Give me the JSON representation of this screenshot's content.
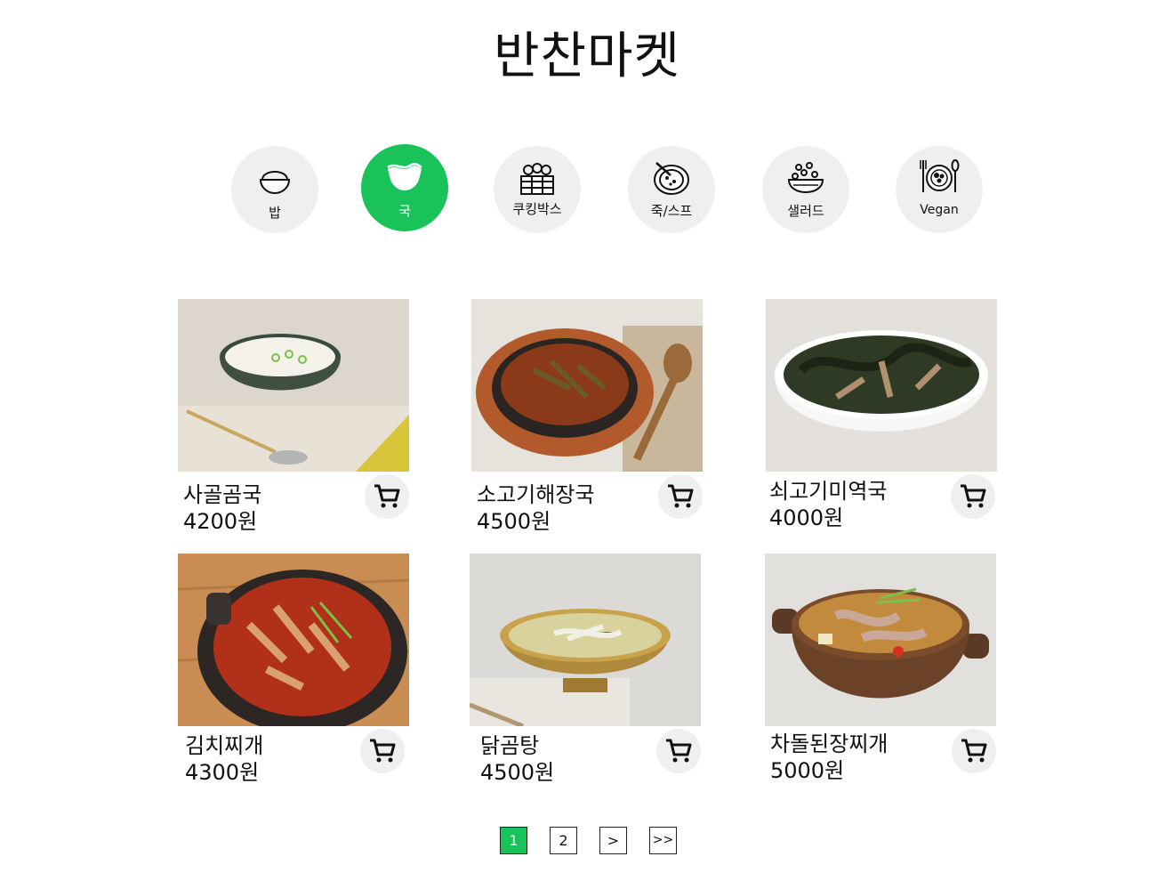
{
  "header": {
    "title": "반찬마켓"
  },
  "categories": [
    {
      "label": "밥",
      "icon": "rice-bowl-icon",
      "active": false
    },
    {
      "label": "국",
      "icon": "soup-bowl-icon",
      "active": true
    },
    {
      "label": "쿠킹박스",
      "icon": "cooking-box-icon",
      "active": false
    },
    {
      "label": "죽/스프",
      "icon": "porridge-icon",
      "active": false
    },
    {
      "label": "샐러드",
      "icon": "salad-icon",
      "active": false
    },
    {
      "label": "Vegan",
      "icon": "vegan-icon",
      "active": false
    }
  ],
  "products": [
    {
      "name": "사골곰국",
      "price": "4200원"
    },
    {
      "name": "소고기해장국",
      "price": "4500원"
    },
    {
      "name": "쇠고기미역국",
      "price": "4000원"
    },
    {
      "name": "김치찌개",
      "price": "4300원"
    },
    {
      "name": "닭곰탕",
      "price": "4500원"
    },
    {
      "name": "차돌된장찌개",
      "price": "5000원"
    }
  ],
  "pagination": {
    "pages": [
      "1",
      "2"
    ],
    "next": ">",
    "last": ">>",
    "current": "1"
  },
  "colors": {
    "accent": "#19c35a",
    "chip_bg": "#efefef"
  }
}
